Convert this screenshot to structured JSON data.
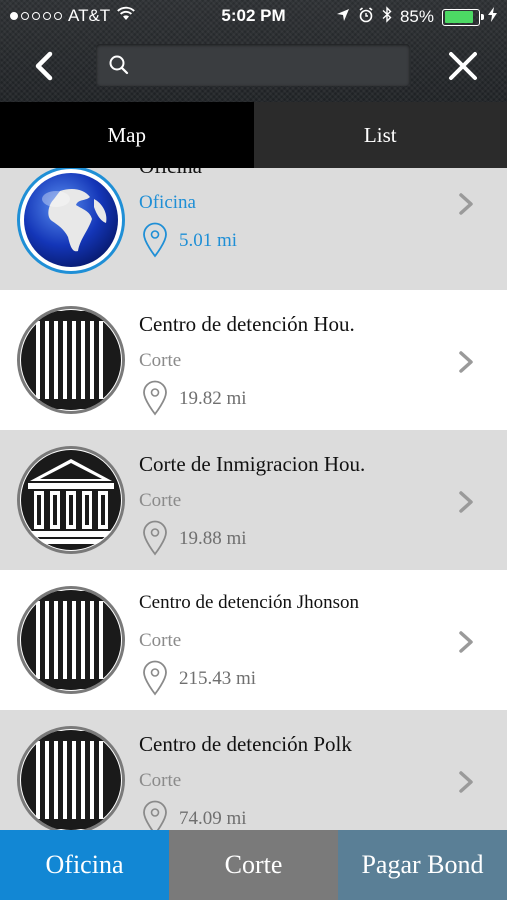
{
  "status_bar": {
    "carrier": "AT&T",
    "time": "5:02 PM",
    "battery_percent": "85%",
    "battery_level": 0.85,
    "signal_bars_filled": 1
  },
  "header": {
    "search_value": "",
    "back_icon": "chevron-left-icon",
    "close_icon": "close-icon"
  },
  "tabs": [
    {
      "label": "Map"
    },
    {
      "label": "List"
    }
  ],
  "items": [
    {
      "title": "Oficina",
      "category": "Oficina",
      "distance": "5.01 mi",
      "icon": "globe-icon",
      "highlight": true
    },
    {
      "title": "Centro de detención Hou.",
      "category": "Corte",
      "distance": "19.82 mi",
      "icon": "jail-bars-icon",
      "highlight": false
    },
    {
      "title": "Corte de Inmigracion Hou.",
      "category": "Corte",
      "distance": "19.88 mi",
      "icon": "courthouse-icon",
      "highlight": false
    },
    {
      "title": "Centro de detención Jhonson",
      "category": "Corte",
      "distance": "215.43 mi",
      "icon": "jail-bars-icon",
      "highlight": false
    },
    {
      "title": "Centro de detención Polk",
      "category": "Corte",
      "distance": "74.09 mi",
      "icon": "jail-bars-icon",
      "highlight": false
    }
  ],
  "bottom_nav": [
    {
      "label": "Oficina"
    },
    {
      "label": "Corte"
    },
    {
      "label": "Pagar Bond"
    }
  ],
  "colors": {
    "accent_blue": "#1287d4",
    "corte_gray": "#7a7a7a",
    "bond_slate": "#5a7f96",
    "battery_green": "#4cd964"
  }
}
